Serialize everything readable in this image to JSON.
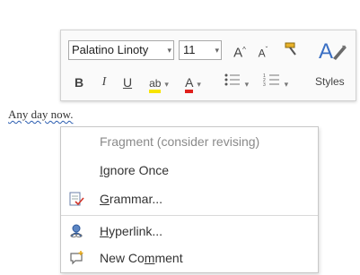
{
  "toolbar": {
    "font_name": "Palatino Linoty",
    "font_size": "11",
    "grow_font": "A",
    "shrink_font": "A",
    "bold": "B",
    "italic": "I",
    "underline": "U",
    "highlight": "ab",
    "font_color": "A",
    "styles_label": "Styles",
    "colors": {
      "highlight": "#f7e400",
      "font_color": "#e0201c",
      "styles_accent": "#3a6fc4"
    }
  },
  "document": {
    "text": "Any day now."
  },
  "context_menu": {
    "items": [
      {
        "label": "Fragment (consider revising)",
        "disabled": true,
        "icon": ""
      },
      {
        "label_pre": "",
        "label_acc": "I",
        "label_post": "gnore Once",
        "icon": ""
      },
      {
        "label_pre": "",
        "label_acc": "G",
        "label_post": "rammar...",
        "icon": "grammar-check-icon"
      },
      {
        "label_pre": "",
        "label_acc": "H",
        "label_post": "yperlink...",
        "icon": "hyperlink-icon"
      },
      {
        "label_pre": "New Co",
        "label_acc": "m",
        "label_post": "ment",
        "icon": "new-comment-icon"
      }
    ]
  }
}
